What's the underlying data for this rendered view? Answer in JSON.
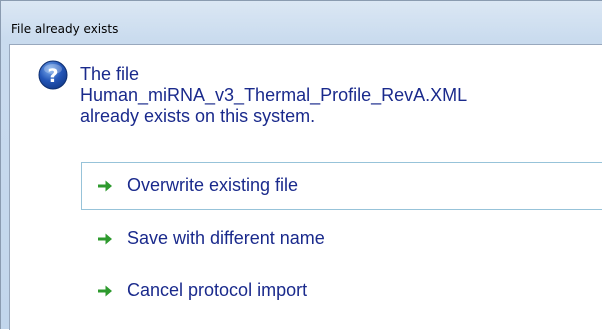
{
  "window": {
    "title": "File already exists"
  },
  "icons": {
    "dialog_icon": "question-icon",
    "command_icon": "green-arrow-icon"
  },
  "colors": {
    "text_primary": "#1a2a8c",
    "arrow_green": "#2e9a2e",
    "icon_blue": "#2456b8",
    "hover_border": "#97c3d9"
  },
  "message": {
    "line1": "The file",
    "line2": "Human_miRNA_v3_Thermal_Profile_RevA.XML",
    "line3": "already exists on this system."
  },
  "commands": [
    {
      "label": "Overwrite existing file",
      "highlighted": true
    },
    {
      "label": "Save with different name",
      "highlighted": false
    },
    {
      "label": "Cancel protocol import",
      "highlighted": false
    }
  ]
}
